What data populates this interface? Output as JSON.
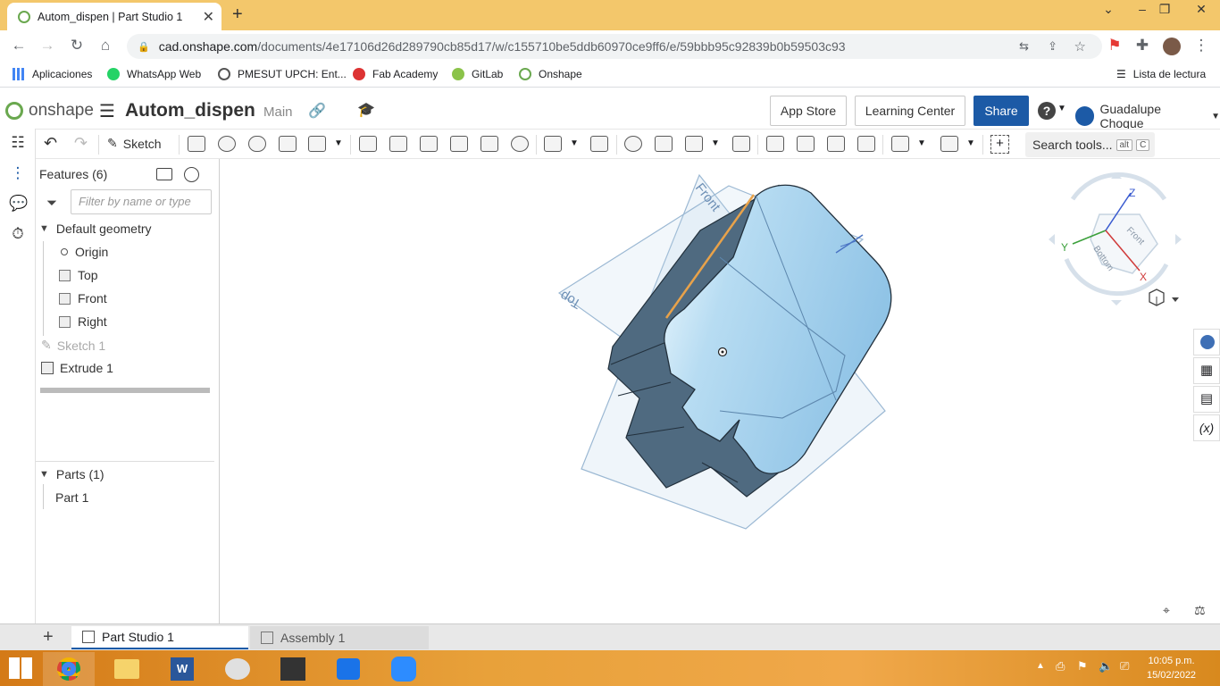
{
  "browser": {
    "tab_title": "Autom_dispen | Part Studio 1",
    "url_host": "cad.onshape.com",
    "url_path": "/documents/4e17106d26d289790cb85d17/w/c155710be5ddb60970ce9ff6/e/59bbb95c92839b0b59503c93",
    "bookmarks": [
      "Aplicaciones",
      "WhatsApp Web",
      "PMESUT UPCH: Ent...",
      "Fab Academy",
      "GitLab",
      "Onshape"
    ],
    "reading_list": "Lista de lectura"
  },
  "header": {
    "logo_text": "onshape",
    "doc_name": "Autom_dispen",
    "branch": "Main",
    "app_store": "App Store",
    "learning_center": "Learning Center",
    "share": "Share",
    "help": "?",
    "user_name": "Guadalupe Choque"
  },
  "toolbar": {
    "sketch_label": "Sketch",
    "search_label": "Search tools...",
    "kbd_alt": "alt",
    "kbd_c": "C"
  },
  "features": {
    "title": "Features (6)",
    "filter_placeholder": "Filter by name or type",
    "default_geometry": "Default geometry",
    "origin": "Origin",
    "top": "Top",
    "front": "Front",
    "right": "Right",
    "sketch1": "Sketch 1",
    "extrude1": "Extrude 1",
    "parts_title": "Parts (1)",
    "part1": "Part 1"
  },
  "viewport": {
    "plane_front": "Front",
    "plane_top": "Top",
    "cube_front": "Front",
    "cube_bottom": "Bottom",
    "axis_x": "X",
    "axis_y": "Y",
    "axis_z": "Z"
  },
  "tabs": {
    "part_studio": "Part Studio 1",
    "assembly": "Assembly 1"
  },
  "taskbar": {
    "time": "10:05 p.m.",
    "date": "15/02/2022"
  },
  "colors": {
    "accent": "#1c5aa6",
    "tabstrip": "#f3c76b",
    "part_face": "#9ccbec",
    "part_side": "#4f6a80"
  }
}
